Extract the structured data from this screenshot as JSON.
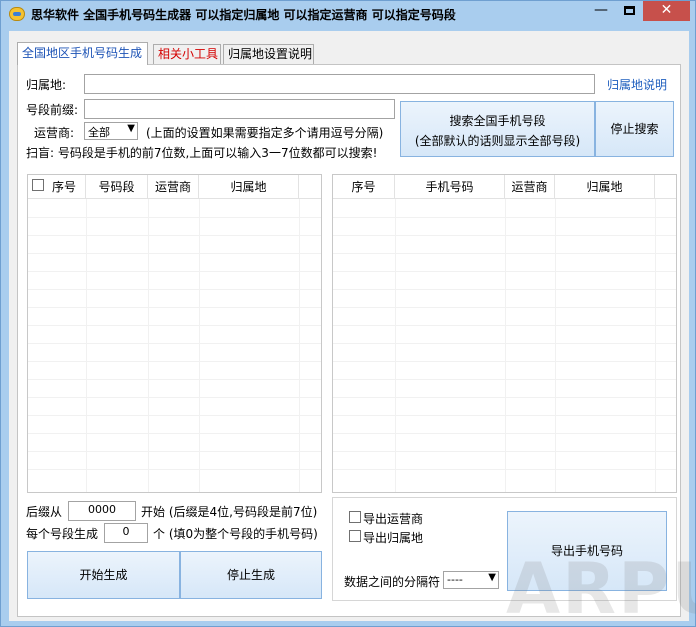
{
  "window": {
    "title": "思华软件  全国手机号码生成器  可以指定归属地  可以指定运营商  可以指定号码段",
    "min_symbol": "—",
    "close_symbol": "✕",
    "colors": {
      "frame": "#a9cdee",
      "close": "#c7504b",
      "link": "#1f5fbf",
      "tab_active": "#1d53b6",
      "tab_red": "#d40000"
    }
  },
  "tabs": [
    "全国地区手机号码生成",
    "相关小工具",
    "归属地设置说明"
  ],
  "form": {
    "location_label": "归属地:",
    "location_value": "",
    "location_help_link": "归属地说明",
    "prefix_label": "号段前缀:",
    "prefix_value": "",
    "carrier_label": "运营商:",
    "carrier_selected": "全部",
    "carrier_hint": "(上面的设置如果需要指定多个请用逗号分隔)",
    "scan_note": "扫盲: 号码段是手机的前7位数,上面可以输入3一7位数都可以搜索!",
    "search_button_line1": "搜索全国手机号段",
    "search_button_line2": "(全部默认的话则显示全部号段)",
    "stop_search_button": "停止搜索"
  },
  "left_table": {
    "columns": [
      "序号",
      "号码段",
      "运营商",
      "归属地"
    ],
    "rows": []
  },
  "right_table": {
    "columns": [
      "序号",
      "手机号码",
      "运营商",
      "归属地"
    ],
    "rows": []
  },
  "generate": {
    "suffix_from_label": "后缀从",
    "suffix_from_value": "0000",
    "suffix_start_hint": "开始 (后缀是4位,号码段是前7位)",
    "per_segment_label": "每个号段生成",
    "per_segment_value": "0",
    "per_segment_hint": "个 (填0为整个号段的手机号码)",
    "start_button": "开始生成",
    "stop_button": "停止生成"
  },
  "export": {
    "export_carrier_label": "导出运营商",
    "export_carrier_checked": false,
    "export_location_label": "导出归属地",
    "export_location_checked": false,
    "separator_label": "数据之间的分隔符",
    "separator_value": "----",
    "export_button": "导出手机号码"
  },
  "watermark": "ARPUN"
}
